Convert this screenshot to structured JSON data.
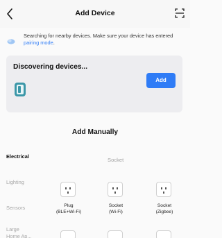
{
  "header": {
    "title": "Add Device"
  },
  "notice": {
    "text_prefix": "Searching for nearby devices. Make sure your device has entered ",
    "link_text": "pairing mode",
    "text_suffix": "."
  },
  "discover": {
    "title": "Discovering devices...",
    "add_label": "Add"
  },
  "manual": {
    "title": "Add Manually",
    "group_label": "Socket"
  },
  "sidebar": {
    "items": [
      {
        "label": "Electrical",
        "active": true
      },
      {
        "label": "Lighting",
        "active": false
      },
      {
        "label": "Sensors",
        "active": false
      },
      {
        "label": "Large Home Ap...",
        "active": false
      }
    ]
  },
  "devices": [
    {
      "name": "Plug",
      "sub": "(BLE+Wi-Fi)",
      "icon": "outlet-icon"
    },
    {
      "name": "Socket",
      "sub": "(Wi-Fi)",
      "icon": "outlet-icon"
    },
    {
      "name": "Socket",
      "sub": "(Zigbee)",
      "icon": "outlet-icon"
    }
  ],
  "colors": {
    "accent": "#2f7cf6",
    "card_bg": "#ededf0",
    "muted_text": "#a7a7a7"
  }
}
